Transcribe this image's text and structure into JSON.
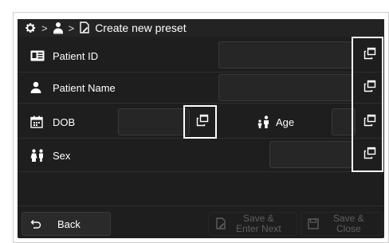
{
  "breadcrumb": {
    "current": "Create new preset"
  },
  "rows": {
    "patient_id": "Patient ID",
    "patient_name": "Patient Name",
    "dob": "DOB",
    "age": "Age",
    "sex": "Sex"
  },
  "footer": {
    "back": "Back",
    "save_enter_next_line1": "Save &",
    "save_enter_next_line2": "Enter Next",
    "save_close_line1": "Save &",
    "save_close_line2": "Close"
  },
  "colors": {
    "background": "#1e1e1e",
    "highlight": "#ffffff",
    "disabled_text": "#5e5e5e"
  },
  "icons": [
    "gear-icon",
    "user-icon",
    "document-edit-icon",
    "id-card-icon",
    "person-icon",
    "calendar-icon",
    "parent-child-icon",
    "people-icon",
    "popup-window-icon",
    "back-arrow-icon",
    "save-icon"
  ]
}
